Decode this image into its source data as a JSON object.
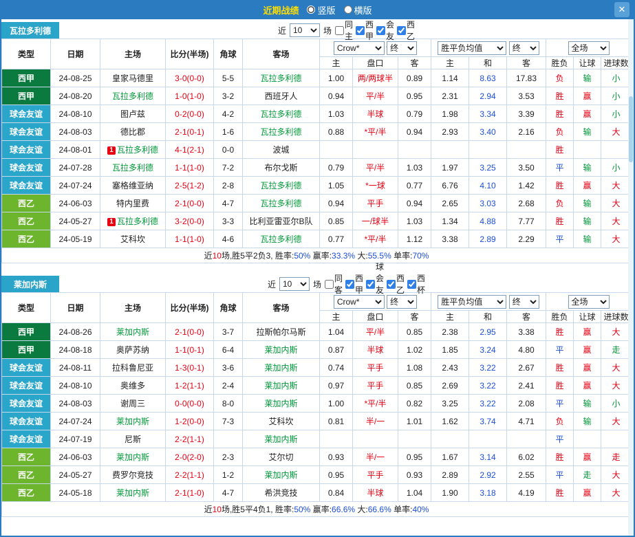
{
  "colors": {
    "r": "#e60012",
    "g": "#009938",
    "b": "#1c4fd6",
    "k": "#222222"
  },
  "league_colors": {
    "西甲": "#0b7a3f",
    "球会友谊": "#2ba6cb",
    "西乙": "#6cb52d"
  },
  "titlebar": {
    "title": "近期战绩",
    "vertical_label": "竖版",
    "horizontal_label": "横版",
    "vertical_selected": true,
    "horizontal_selected": false,
    "close_glyph": "✕"
  },
  "columns": [
    "类型",
    "日期",
    "主场",
    "比分(半场)",
    "角球",
    "客场"
  ],
  "subcolumns": [
    "主",
    "盘口",
    "客",
    "主",
    "和",
    "客",
    "胜负",
    "让球",
    "进球数"
  ],
  "sections": [
    {
      "team": "瓦拉多利德",
      "filter": {
        "near": "近",
        "count": "10",
        "unit": "场",
        "checks": [
          {
            "label": "同主",
            "checked": false
          },
          {
            "label": "西甲",
            "checked": true
          },
          {
            "label": "球会友谊",
            "checked": true
          },
          {
            "label": "西乙",
            "checked": true
          }
        ]
      },
      "dropdowns": {
        "company": "Crow*",
        "company_time": "终",
        "europe": "胜平负均值",
        "europe_time": "终",
        "scope": "全场"
      },
      "rows": [
        {
          "lg": "西甲",
          "date": "24-08-25",
          "home": "皇家马德里",
          "hT": false,
          "hb": "",
          "score": "3-0(0-0)",
          "corner": "5-5",
          "away": "瓦拉多利德",
          "aT": true,
          "ah": "1.00",
          "hc": "两/两球半",
          "aa": "0.89",
          "eh": "1.14",
          "ed": "8.63",
          "ea": "17.83",
          "res": [
            "负",
            "r"
          ],
          "han": [
            "输",
            "g"
          ],
          "gl": [
            "小",
            "g"
          ]
        },
        {
          "lg": "西甲",
          "date": "24-08-20",
          "home": "瓦拉多利德",
          "hT": true,
          "hb": "",
          "score": "1-0(1-0)",
          "corner": "3-2",
          "away": "西班牙人",
          "aT": false,
          "ah": "0.94",
          "hc": "平/半",
          "aa": "0.95",
          "eh": "2.31",
          "ed": "2.94",
          "ea": "3.53",
          "res": [
            "胜",
            "r"
          ],
          "han": [
            "赢",
            "r"
          ],
          "gl": [
            "小",
            "g"
          ]
        },
        {
          "lg": "球会友谊",
          "date": "24-08-10",
          "home": "图卢兹",
          "hT": false,
          "hb": "",
          "score": "0-2(0-0)",
          "corner": "4-2",
          "away": "瓦拉多利德",
          "aT": true,
          "ah": "1.03",
          "hc": "半球",
          "aa": "0.79",
          "eh": "1.98",
          "ed": "3.34",
          "ea": "3.39",
          "res": [
            "胜",
            "r"
          ],
          "han": [
            "赢",
            "r"
          ],
          "gl": [
            "小",
            "g"
          ]
        },
        {
          "lg": "球会友谊",
          "date": "24-08-03",
          "home": "德比郡",
          "hT": false,
          "hb": "",
          "score": "2-1(0-1)",
          "corner": "1-6",
          "away": "瓦拉多利德",
          "aT": true,
          "ah": "0.88",
          "hc": "*平/半",
          "aa": "0.94",
          "eh": "2.93",
          "ed": "3.40",
          "ea": "2.16",
          "res": [
            "负",
            "r"
          ],
          "han": [
            "输",
            "g"
          ],
          "gl": [
            "大",
            "r"
          ]
        },
        {
          "lg": "球会友谊",
          "date": "24-08-01",
          "home": "瓦拉多利德",
          "hT": true,
          "hb": "1",
          "score": "4-1(2-1)",
          "corner": "0-0",
          "away": "波城",
          "aT": false,
          "ah": "",
          "hc": "",
          "aa": "",
          "eh": "",
          "ed": "",
          "ea": "",
          "res": [
            "胜",
            "r"
          ],
          "han": [
            "",
            "k"
          ],
          "gl": [
            "",
            "k"
          ]
        },
        {
          "lg": "球会友谊",
          "date": "24-07-28",
          "home": "瓦拉多利德",
          "hT": true,
          "hb": "",
          "score": "1-1(1-0)",
          "corner": "7-2",
          "away": "布尔戈斯",
          "aT": false,
          "ah": "0.79",
          "hc": "平/半",
          "aa": "1.03",
          "eh": "1.97",
          "ed": "3.25",
          "ea": "3.50",
          "res": [
            "平",
            "b"
          ],
          "han": [
            "输",
            "g"
          ],
          "gl": [
            "小",
            "g"
          ]
        },
        {
          "lg": "球会友谊",
          "date": "24-07-24",
          "home": "塞格维亚纳",
          "hT": false,
          "hb": "",
          "score": "2-5(1-2)",
          "corner": "2-8",
          "away": "瓦拉多利德",
          "aT": true,
          "ah": "1.05",
          "hc": "*一球",
          "aa": "0.77",
          "eh": "6.76",
          "ed": "4.10",
          "ea": "1.42",
          "res": [
            "胜",
            "r"
          ],
          "han": [
            "赢",
            "r"
          ],
          "gl": [
            "大",
            "r"
          ]
        },
        {
          "lg": "西乙",
          "date": "24-06-03",
          "home": "特内里费",
          "hT": false,
          "hb": "",
          "score": "2-1(0-0)",
          "corner": "4-7",
          "away": "瓦拉多利德",
          "aT": true,
          "ah": "0.94",
          "hc": "平手",
          "aa": "0.94",
          "eh": "2.65",
          "ed": "3.03",
          "ea": "2.68",
          "res": [
            "负",
            "r"
          ],
          "han": [
            "输",
            "g"
          ],
          "gl": [
            "大",
            "r"
          ]
        },
        {
          "lg": "西乙",
          "date": "24-05-27",
          "home": "瓦拉多利德",
          "hT": true,
          "hb": "1",
          "score": "3-2(0-0)",
          "corner": "3-3",
          "away": "比利亚雷亚尔B队",
          "aT": false,
          "ah": "0.85",
          "hc": "一/球半",
          "aa": "1.03",
          "eh": "1.34",
          "ed": "4.88",
          "ea": "7.77",
          "res": [
            "胜",
            "r"
          ],
          "han": [
            "输",
            "g"
          ],
          "gl": [
            "大",
            "r"
          ]
        },
        {
          "lg": "西乙",
          "date": "24-05-19",
          "home": "艾科坎",
          "hT": false,
          "hb": "",
          "score": "1-1(1-0)",
          "corner": "4-6",
          "away": "瓦拉多利德",
          "aT": true,
          "ah": "0.77",
          "hc": "*平/半",
          "aa": "1.12",
          "eh": "3.38",
          "ed": "2.89",
          "ea": "2.29",
          "res": [
            "平",
            "b"
          ],
          "han": [
            "输",
            "g"
          ],
          "gl": [
            "大",
            "r"
          ]
        }
      ],
      "summary": [
        {
          "t": "近",
          "c": "k"
        },
        {
          "t": "10",
          "c": "r"
        },
        {
          "t": "场,胜5平2负3, ",
          "c": "k"
        },
        {
          "t": "胜率:",
          "c": "k"
        },
        {
          "t": "50%",
          "c": "b"
        },
        {
          "t": " 赢率:",
          "c": "k"
        },
        {
          "t": "33.3%",
          "c": "b"
        },
        {
          "t": " 大:",
          "c": "k"
        },
        {
          "t": "55.5%",
          "c": "b"
        },
        {
          "t": " 单率:",
          "c": "k"
        },
        {
          "t": "70%",
          "c": "b"
        }
      ]
    },
    {
      "team": "莱加内斯",
      "filter": {
        "near": "近",
        "count": "10",
        "unit": "场",
        "checks": [
          {
            "label": "同客",
            "checked": false
          },
          {
            "label": "西甲",
            "checked": true
          },
          {
            "label": "球会友谊",
            "checked": true
          },
          {
            "label": "西乙",
            "checked": true
          },
          {
            "label": "西杯",
            "checked": true
          }
        ]
      },
      "dropdowns": {
        "company": "Crow*",
        "company_time": "终",
        "europe": "胜平负均值",
        "europe_time": "终",
        "scope": "全场"
      },
      "rows": [
        {
          "lg": "西甲",
          "date": "24-08-26",
          "home": "莱加内斯",
          "hT": true,
          "hb": "",
          "score": "2-1(0-0)",
          "corner": "3-7",
          "away": "拉斯帕尔马斯",
          "aT": false,
          "ah": "1.04",
          "hc": "平/半",
          "aa": "0.85",
          "eh": "2.38",
          "ed": "2.95",
          "ea": "3.38",
          "res": [
            "胜",
            "r"
          ],
          "han": [
            "赢",
            "r"
          ],
          "gl": [
            "大",
            "r"
          ]
        },
        {
          "lg": "西甲",
          "date": "24-08-18",
          "home": "奥萨苏纳",
          "hT": false,
          "hb": "",
          "score": "1-1(0-1)",
          "corner": "6-4",
          "away": "莱加内斯",
          "aT": true,
          "ah": "0.87",
          "hc": "半球",
          "aa": "1.02",
          "eh": "1.85",
          "ed": "3.24",
          "ea": "4.80",
          "res": [
            "平",
            "b"
          ],
          "han": [
            "赢",
            "r"
          ],
          "gl": [
            "走",
            "g"
          ]
        },
        {
          "lg": "球会友谊",
          "date": "24-08-11",
          "home": "拉科鲁尼亚",
          "hT": false,
          "hb": "",
          "score": "1-3(0-1)",
          "corner": "3-6",
          "away": "莱加内斯",
          "aT": true,
          "ah": "0.74",
          "hc": "平手",
          "aa": "1.08",
          "eh": "2.43",
          "ed": "3.22",
          "ea": "2.67",
          "res": [
            "胜",
            "r"
          ],
          "han": [
            "赢",
            "r"
          ],
          "gl": [
            "大",
            "r"
          ]
        },
        {
          "lg": "球会友谊",
          "date": "24-08-10",
          "home": "奥维多",
          "hT": false,
          "hb": "",
          "score": "1-2(1-1)",
          "corner": "2-4",
          "away": "莱加内斯",
          "aT": true,
          "ah": "0.97",
          "hc": "平手",
          "aa": "0.85",
          "eh": "2.69",
          "ed": "3.22",
          "ea": "2.41",
          "res": [
            "胜",
            "r"
          ],
          "han": [
            "赢",
            "r"
          ],
          "gl": [
            "大",
            "r"
          ]
        },
        {
          "lg": "球会友谊",
          "date": "24-08-03",
          "home": "谢周三",
          "hT": false,
          "hb": "",
          "score": "0-0(0-0)",
          "corner": "8-0",
          "away": "莱加内斯",
          "aT": true,
          "ah": "1.00",
          "hc": "*平/半",
          "aa": "0.82",
          "eh": "3.25",
          "ed": "3.22",
          "ea": "2.08",
          "res": [
            "平",
            "b"
          ],
          "han": [
            "输",
            "g"
          ],
          "gl": [
            "小",
            "g"
          ]
        },
        {
          "lg": "球会友谊",
          "date": "24-07-24",
          "home": "莱加内斯",
          "hT": true,
          "hb": "",
          "score": "1-2(0-0)",
          "corner": "7-3",
          "away": "艾科坎",
          "aT": false,
          "ah": "0.81",
          "hc": "半/一",
          "aa": "1.01",
          "eh": "1.62",
          "ed": "3.74",
          "ea": "4.71",
          "res": [
            "负",
            "r"
          ],
          "han": [
            "输",
            "g"
          ],
          "gl": [
            "大",
            "r"
          ]
        },
        {
          "lg": "球会友谊",
          "date": "24-07-19",
          "home": "尼斯",
          "hT": false,
          "hb": "",
          "score": "2-2(1-1)",
          "corner": "",
          "away": "莱加内斯",
          "aT": true,
          "ah": "",
          "hc": "",
          "aa": "",
          "eh": "",
          "ed": "",
          "ea": "",
          "res": [
            "平",
            "b"
          ],
          "han": [
            "",
            "k"
          ],
          "gl": [
            "",
            "k"
          ]
        },
        {
          "lg": "西乙",
          "date": "24-06-03",
          "home": "莱加内斯",
          "hT": true,
          "hb": "",
          "score": "2-0(2-0)",
          "corner": "2-3",
          "away": "艾尔切",
          "aT": false,
          "ah": "0.93",
          "hc": "半/一",
          "aa": "0.95",
          "eh": "1.67",
          "ed": "3.14",
          "ea": "6.02",
          "res": [
            "胜",
            "r"
          ],
          "han": [
            "赢",
            "r"
          ],
          "gl": [
            "走",
            "r"
          ]
        },
        {
          "lg": "西乙",
          "date": "24-05-27",
          "home": "费罗尔竞技",
          "hT": false,
          "hb": "",
          "score": "2-2(1-1)",
          "corner": "1-2",
          "away": "莱加内斯",
          "aT": true,
          "ah": "0.95",
          "hc": "平手",
          "aa": "0.93",
          "eh": "2.89",
          "ed": "2.92",
          "ea": "2.55",
          "res": [
            "平",
            "b"
          ],
          "han": [
            "走",
            "g"
          ],
          "gl": [
            "大",
            "r"
          ]
        },
        {
          "lg": "西乙",
          "date": "24-05-18",
          "home": "莱加内斯",
          "hT": true,
          "hb": "",
          "score": "2-1(1-0)",
          "corner": "4-7",
          "away": "希洪竞技",
          "aT": false,
          "ah": "0.84",
          "hc": "半球",
          "aa": "1.04",
          "eh": "1.90",
          "ed": "3.18",
          "ea": "4.19",
          "res": [
            "胜",
            "r"
          ],
          "han": [
            "赢",
            "r"
          ],
          "gl": [
            "大",
            "r"
          ]
        }
      ],
      "summary": [
        {
          "t": "近",
          "c": "k"
        },
        {
          "t": "10",
          "c": "r"
        },
        {
          "t": "场,胜5平4负1, ",
          "c": "k"
        },
        {
          "t": "胜率:",
          "c": "k"
        },
        {
          "t": "50%",
          "c": "b"
        },
        {
          "t": " 赢率:",
          "c": "k"
        },
        {
          "t": "66.6%",
          "c": "b"
        },
        {
          "t": " 大:",
          "c": "k"
        },
        {
          "t": "66.6%",
          "c": "b"
        },
        {
          "t": " 单率:",
          "c": "k"
        },
        {
          "t": "40%",
          "c": "b"
        }
      ]
    }
  ]
}
